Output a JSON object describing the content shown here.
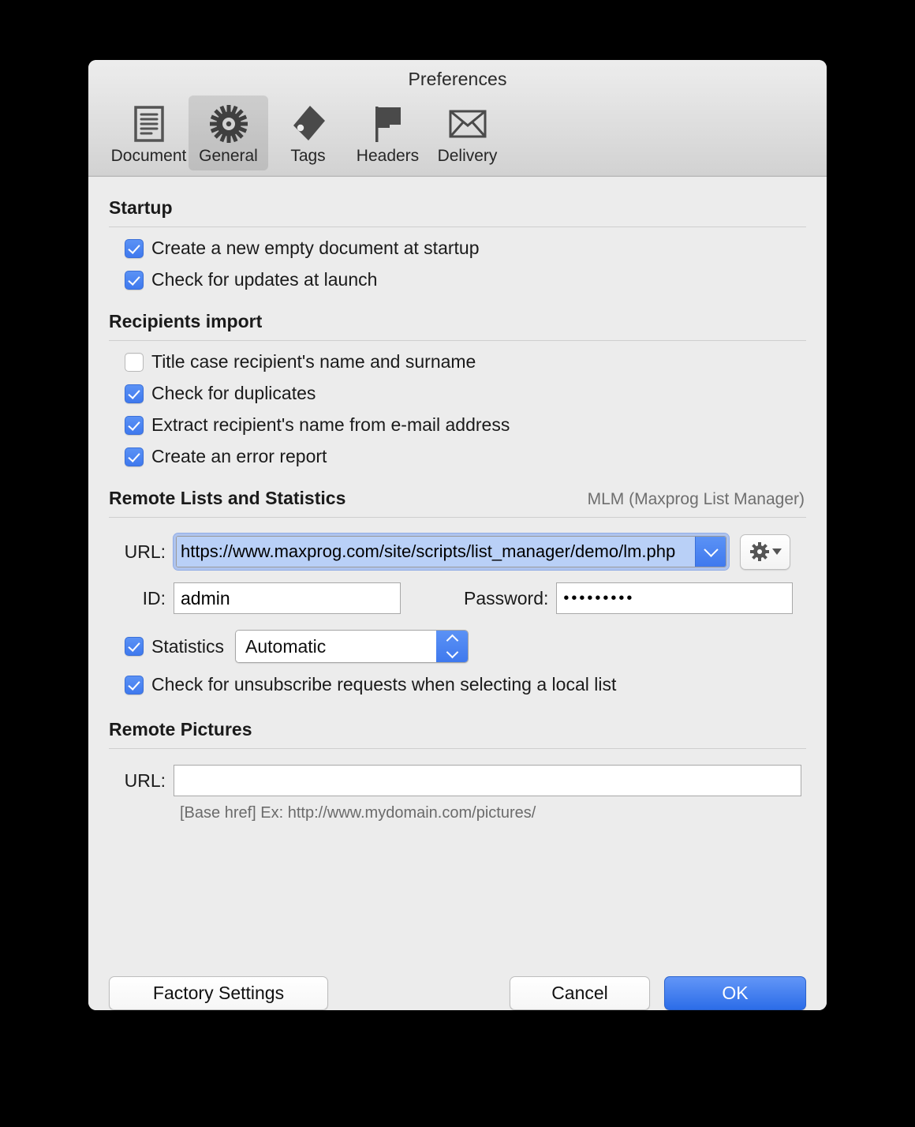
{
  "window": {
    "title": "Preferences"
  },
  "toolbar": {
    "items": [
      {
        "label": "Document",
        "icon": "document-icon",
        "selected": false
      },
      {
        "label": "General",
        "icon": "gear-icon",
        "selected": true
      },
      {
        "label": "Tags",
        "icon": "tag-icon",
        "selected": false
      },
      {
        "label": "Headers",
        "icon": "flag-icon",
        "selected": false
      },
      {
        "label": "Delivery",
        "icon": "envelope-icon",
        "selected": false
      }
    ]
  },
  "sections": {
    "startup": {
      "title": "Startup",
      "checkboxes": [
        {
          "label": "Create a new empty document at startup",
          "checked": true
        },
        {
          "label": "Check for updates at launch",
          "checked": true
        }
      ]
    },
    "recipients_import": {
      "title": "Recipients import",
      "checkboxes": [
        {
          "label": "Title case recipient's name and surname",
          "checked": false
        },
        {
          "label": "Check for duplicates",
          "checked": true
        },
        {
          "label": "Extract recipient's name from e-mail address",
          "checked": true
        },
        {
          "label": "Create an error report",
          "checked": true
        }
      ]
    },
    "remote_lists": {
      "title": "Remote Lists and Statistics",
      "note": "MLM (Maxprog List Manager)",
      "url_label": "URL:",
      "url_value": "https://www.maxprog.com/site/scripts/list_manager/demo/lm.php",
      "id_label": "ID:",
      "id_value": "admin",
      "password_label": "Password:",
      "password_value": "•••••••••",
      "statistics_label": "Statistics",
      "statistics_checked": true,
      "statistics_value": "Automatic",
      "statistics_options": [
        "Automatic"
      ],
      "unsubscribe_label": "Check for unsubscribe requests when selecting a local list",
      "unsubscribe_checked": true
    },
    "remote_pictures": {
      "title": "Remote Pictures",
      "url_label": "URL:",
      "url_value": "",
      "url_placeholder": "",
      "hint": "[Base href] Ex: http://www.mydomain.com/pictures/"
    }
  },
  "buttons": {
    "factory_settings": "Factory Settings",
    "cancel": "Cancel",
    "ok": "OK"
  },
  "colors": {
    "accent_blue": "#4A84F0",
    "default_button_blue": "#2C6DE8",
    "selection_blue": "#B9D0F7",
    "window_bg": "#ECECEC",
    "separator": "#CFCFCF",
    "muted_text": "#6E6E6E"
  }
}
